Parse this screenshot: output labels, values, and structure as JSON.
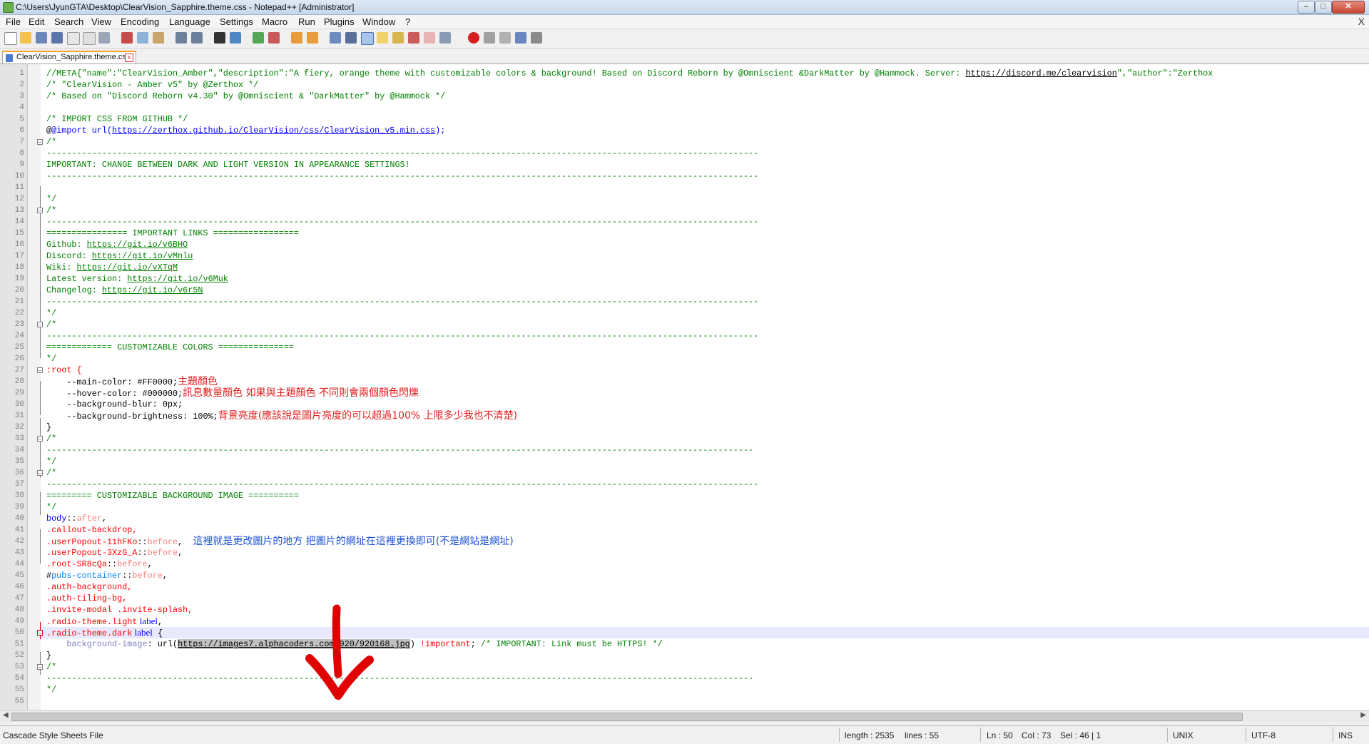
{
  "window": {
    "title": "C:\\Users\\JyunGTA\\Desktop\\ClearVision_Sapphire.theme.css - Notepad++ [Administrator]"
  },
  "menu": [
    "File",
    "Edit",
    "Search",
    "View",
    "Encoding",
    "Language",
    "Settings",
    "Macro",
    "Run",
    "Plugins",
    "Window",
    "?"
  ],
  "menu_close": "X",
  "tab": {
    "label": "ClearVision_Sapphire.theme.css",
    "close": "x"
  },
  "status": {
    "file_type": "Cascade Style Sheets File",
    "length": "length : 2535",
    "lines": "lines : 55",
    "ln": "Ln : 50",
    "col": "Col : 73",
    "sel": "Sel : 46 | 1",
    "eol": "UNIX",
    "encoding": "UTF-8",
    "mode": "INS"
  },
  "annotations": {
    "main_color": "主題顏色",
    "hover_color": "訊息數量顏色 如果與主題顏色 不同則會兩個顏色閃爍",
    "brightness": "背景亮度(應該說是圖片亮度的可以超過100% 上限多少我也不清楚)",
    "bg_image": "這裡就是更改圖片的地方 把圖片的網址在這裡更換即可(不是網站是網址)"
  },
  "code": {
    "l1_a": "//META{\"name\":\"ClearVision_Amber\",\"description\":\"A fiery, orange theme with customizable colors & background! Based on Discord Reborn by @Omniscient &DarkMatter by @Hammock. Server: ",
    "l1_link": "https://discord.me/clearvision",
    "l1_b": "\",\"author\":\"Zerthox",
    "l2": "/* \"ClearVision - Amber v5\" by @Zerthox */",
    "l3": "/* Based on \"Discord Reborn v4.30\" by @Omniscient & \"DarkMatter\" by @Hammock */",
    "l5": "/* IMPORT CSS FROM GITHUB */",
    "l6_a": "@import url(",
    "l6_link": "https://zerthox.github.io/ClearVision/css/ClearVision_v5.min.css",
    "l6_b": ");",
    "comment_open": "/*",
    "comment_close": "*/",
    "dash_long": "---------------------------------------------------------------------------------------------------------------------------------------------",
    "dash_short": "--------------------------------------------------------------------------------------------------------------------------------------------",
    "l9": "IMPORTANT: CHANGE BETWEEN DARK AND LIGHT VERSION IN APPEARANCE SETTINGS!",
    "l14": "================ IMPORTANT LINKS =================",
    "l15_a": "Github: ",
    "l15_link": "https://git.io/v6BHO",
    "l16_a": "Discord: ",
    "l16_link": "https://git.io/vMnlu",
    "l17_a": "Wiki: ",
    "l17_link": "https://git.io/vXTqM",
    "l18_a": "Latest version: ",
    "l18_link": "https://git.io/v6Muk",
    "l19_a": "Changelog: ",
    "l19_link": "https://git.io/v6r5N",
    "l24": "============= CUSTOMIZABLE COLORS ===============",
    "l26": ":root {",
    "l27": "    --main-color: #FF0000;",
    "l28": "    --hover-color: #000000;",
    "l29": "    --background-blur: 0px;",
    "l30": "    --background-brightness: 100%;",
    "l31": "}",
    "l37": "========= CUSTOMIZABLE BACKGROUND IMAGE ==========",
    "l39_a": "body",
    "l39_b": "::",
    "l39_c": "after",
    "l39_d": ",",
    "l40": ".callout-backdrop,",
    "l41_a": ".userPopout-11hFKo",
    "l41_b": "::",
    "l41_c": "before",
    "l41_d": ",",
    "l42_a": ".userPopout-3XzG_A",
    "l42_b": "::",
    "l42_c": "before",
    "l42_d": ",",
    "l43_a": ".root-SR8cQa",
    "l43_b": "::",
    "l43_c": "before",
    "l43_d": ",",
    "l44_a": "#",
    "l44_b": "pubs-container",
    "l44_c": "::",
    "l44_d": "before",
    "l44_e": ",",
    "l45": ".auth-background,",
    "l46": ".auth-tiling-bg,",
    "l47": ".invite-modal .invite-splash,",
    "l48_a": ".radio-theme.light",
    "l48_b": " label",
    "l48_c": ",",
    "l49_a": ".radio-theme.dark",
    "l49_b": " label",
    "l49_c": " {",
    "l50_a": "    background-image",
    "l50_b": ": url(",
    "l50_link": "https://images7.alphacoders.com/920/920168.jpg",
    "l50_c": ") ",
    "l50_d": "!important",
    "l50_e": "; ",
    "l50_f": "/* IMPORTANT: Link must be HTTPS! */",
    "l51": "}"
  },
  "line_numbers": [
    "1",
    "2",
    "3",
    "4",
    "5",
    "6",
    "7",
    "8",
    "9",
    "10",
    "11",
    "12",
    "13",
    "14",
    "15",
    "16",
    "17",
    "18",
    "19",
    "20",
    "21",
    "22",
    "23",
    "24",
    "25",
    "26",
    "27",
    "28",
    "29",
    "30",
    "31",
    "32",
    "33",
    "34",
    "35",
    "36",
    "37",
    "38",
    "39",
    "40",
    "41",
    "42",
    "43",
    "44",
    "45",
    "46",
    "47",
    "48",
    "49",
    "50",
    "51",
    "52",
    "53",
    "54",
    "55"
  ],
  "colors": {
    "comment": "#008000",
    "keyword": "#0000ff",
    "selector": "#ff0000",
    "pseudo": "#ff8080",
    "value": "#000000",
    "prop": "#8080c0",
    "annotation_red": "#e02020",
    "annotation_blue": "#1a4fd8"
  },
  "icons": [
    "new-file-icon",
    "open-icon",
    "save-icon",
    "save-all-icon",
    "close-icon",
    "close-all-icon",
    "print-icon",
    "cut-icon",
    "copy-icon",
    "paste-icon",
    "undo-icon",
    "redo-icon",
    "find-icon",
    "replace-icon",
    "zoom-in-icon",
    "zoom-out-icon",
    "sync-v-icon",
    "sync-h-icon",
    "word-wrap-icon",
    "all-chars-icon",
    "indent-guide-icon",
    "udl-icon",
    "doc-map-icon",
    "function-list-icon",
    "folder-workspace-icon",
    "monitor-icon",
    "record-macro-icon",
    "stop-macro-icon",
    "play-macro-icon",
    "run-macro-multiple-icon",
    "save-macro-icon"
  ]
}
